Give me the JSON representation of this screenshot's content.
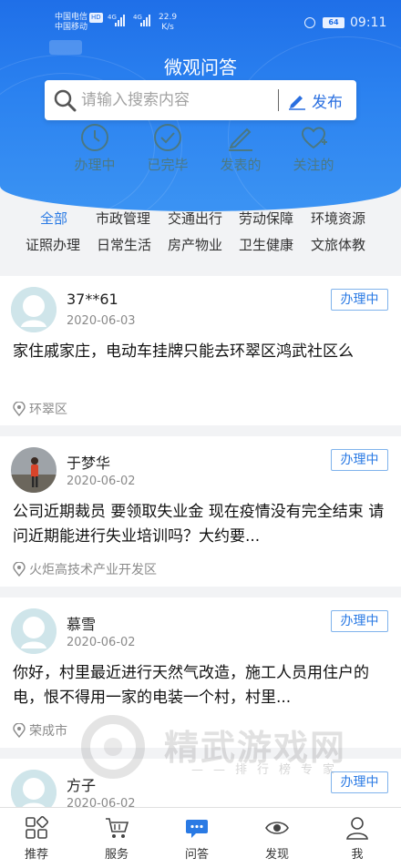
{
  "status_bar": {
    "carrier_1": "中国电信",
    "carrier_1_badge": "HD",
    "carrier_2": "中国移动",
    "signal_1": "4G",
    "signal_2": "4G",
    "net_speed": "22.9",
    "net_speed_unit": "K/s",
    "battery": "64",
    "time": "09:11"
  },
  "header": {
    "title": "微观问答",
    "search_placeholder": "请输入搜索内容",
    "publish_label": "发布"
  },
  "quick_tabs": [
    {
      "label": "办理中",
      "icon": "clock-icon"
    },
    {
      "label": "已完毕",
      "icon": "check-circle-icon"
    },
    {
      "label": "发表的",
      "icon": "pen-icon"
    },
    {
      "label": "关注的",
      "icon": "heart-plus-icon"
    }
  ],
  "categories_row1": [
    "全部",
    "市政管理",
    "交通出行",
    "劳动保障",
    "环境资源"
  ],
  "categories_row2": [
    "证照办理",
    "日常生活",
    "房产物业",
    "卫生健康",
    "文旅体教"
  ],
  "active_category": "全部",
  "posts": [
    {
      "user": "37**61",
      "date": "2020-06-03",
      "status": "办理中",
      "question": "家住戚家庄，电动车挂牌只能去环翠区鸿武社区么",
      "location": "环翠区",
      "avatar": "default-avatar-icon"
    },
    {
      "user": "于梦华",
      "date": "2020-06-02",
      "status": "办理中",
      "question": "公司近期裁员  要领取失业金  现在疫情没有完全结束  请问近期能进行失业培训吗？大约要...",
      "location": "火炬高技术产业开发区",
      "avatar": "photo-avatar"
    },
    {
      "user": "慕雪",
      "date": "2020-06-02",
      "status": "办理中",
      "question": "你好，村里最近进行天然气改造，施工人员用住户的电，恨不得用一家的电装一个村，村里...",
      "location": "荣成市",
      "avatar": "default-avatar-icon"
    },
    {
      "user": "方子",
      "date": "2020-06-02",
      "status": "办理中",
      "avatar": "default-avatar-icon"
    }
  ],
  "watermark": {
    "text": "精武游戏网",
    "subtext": "——排行榜专家"
  },
  "bottom_nav": [
    {
      "label": "推荐",
      "icon": "grid-icon"
    },
    {
      "label": "服务",
      "icon": "cart-icon"
    },
    {
      "label": "问答",
      "icon": "chat-icon"
    },
    {
      "label": "发现",
      "icon": "eye-icon"
    },
    {
      "label": "我",
      "icon": "person-icon"
    }
  ],
  "colors": {
    "header_blue": "#1f6fe8",
    "accent_blue": "#2a7ae4",
    "quick_tab_text": "#5f6a2a",
    "background": "#f2f3f5"
  }
}
